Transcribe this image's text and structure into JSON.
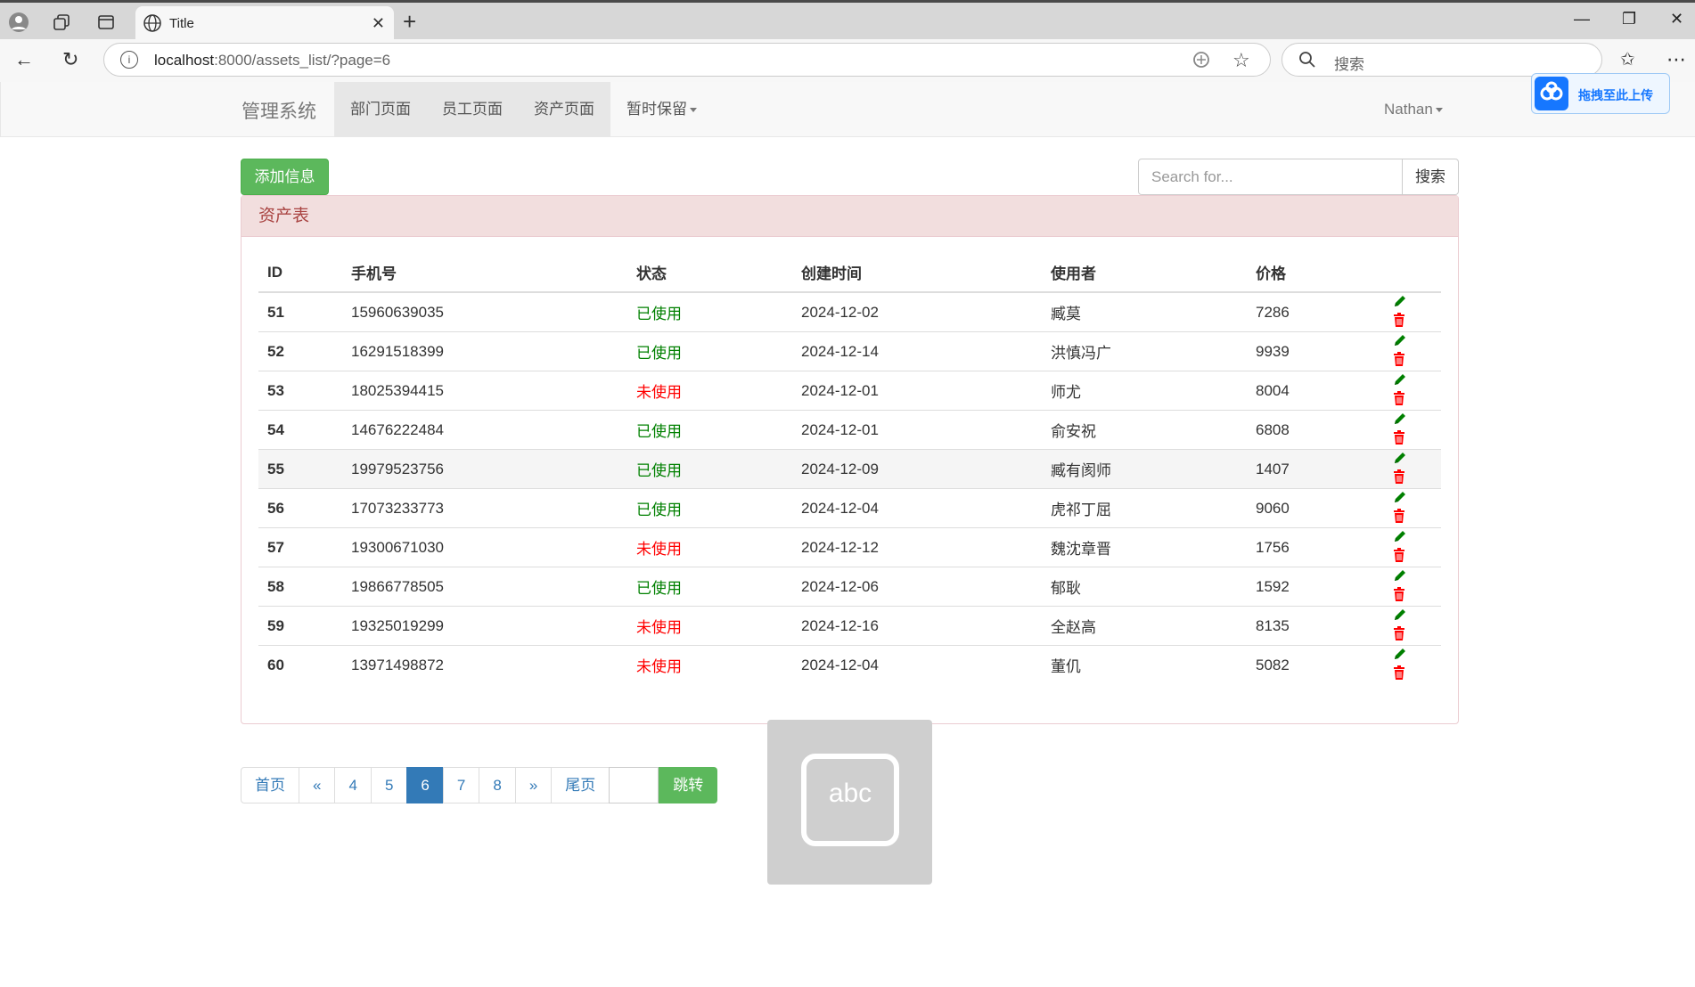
{
  "browser": {
    "tab_title": "Title",
    "url_host": "localhost",
    "url_rest": ":8000/assets_list/?page=6",
    "search_placeholder": "搜索"
  },
  "overlay": {
    "upload_label": "拖拽至此上传",
    "ime_label": "abc"
  },
  "navbar": {
    "brand": "管理系统",
    "links": [
      "部门页面",
      "员工页面",
      "资产页面"
    ],
    "dropdown": "暂时保留",
    "user": "Nathan"
  },
  "toolbar": {
    "add_label": "添加信息",
    "search_placeholder": "Search for...",
    "search_button": "搜索"
  },
  "panel": {
    "title": "资产表",
    "columns": [
      "ID",
      "手机号",
      "状态",
      "创建时间",
      "使用者",
      "价格"
    ],
    "rows": [
      {
        "id": "51",
        "phone": "15960639035",
        "status": "已使用",
        "created": "2024-12-02",
        "user": "臧莫",
        "price": "7286"
      },
      {
        "id": "52",
        "phone": "16291518399",
        "status": "已使用",
        "created": "2024-12-14",
        "user": "洪慎冯广",
        "price": "9939"
      },
      {
        "id": "53",
        "phone": "18025394415",
        "status": "未使用",
        "created": "2024-12-01",
        "user": "师尤",
        "price": "8004"
      },
      {
        "id": "54",
        "phone": "14676222484",
        "status": "已使用",
        "created": "2024-12-01",
        "user": "俞安祝",
        "price": "6808"
      },
      {
        "id": "55",
        "phone": "19979523756",
        "status": "已使用",
        "created": "2024-12-09",
        "user": "臧有阂师",
        "price": "1407"
      },
      {
        "id": "56",
        "phone": "17073233773",
        "status": "已使用",
        "created": "2024-12-04",
        "user": "虎祁丁屈",
        "price": "9060"
      },
      {
        "id": "57",
        "phone": "19300671030",
        "status": "未使用",
        "created": "2024-12-12",
        "user": "魏沈章晋",
        "price": "1756"
      },
      {
        "id": "58",
        "phone": "19866778505",
        "status": "已使用",
        "created": "2024-12-06",
        "user": "郁耿",
        "price": "1592"
      },
      {
        "id": "59",
        "phone": "19325019299",
        "status": "未使用",
        "created": "2024-12-16",
        "user": "全赵高",
        "price": "8135"
      },
      {
        "id": "60",
        "phone": "13971498872",
        "status": "未使用",
        "created": "2024-12-04",
        "user": "董仉",
        "price": "5082"
      }
    ]
  },
  "pagination": {
    "items": [
      "首页",
      "«",
      "4",
      "5",
      "6",
      "7",
      "8",
      "»",
      "尾页"
    ],
    "go_label": "跳转"
  },
  "colors": {
    "used": "#008000",
    "unused": "#ff0000",
    "success": "#5cb85c",
    "primary": "#337ab7",
    "panel_head_bg": "#f2dede",
    "panel_head_text": "#a94442"
  }
}
